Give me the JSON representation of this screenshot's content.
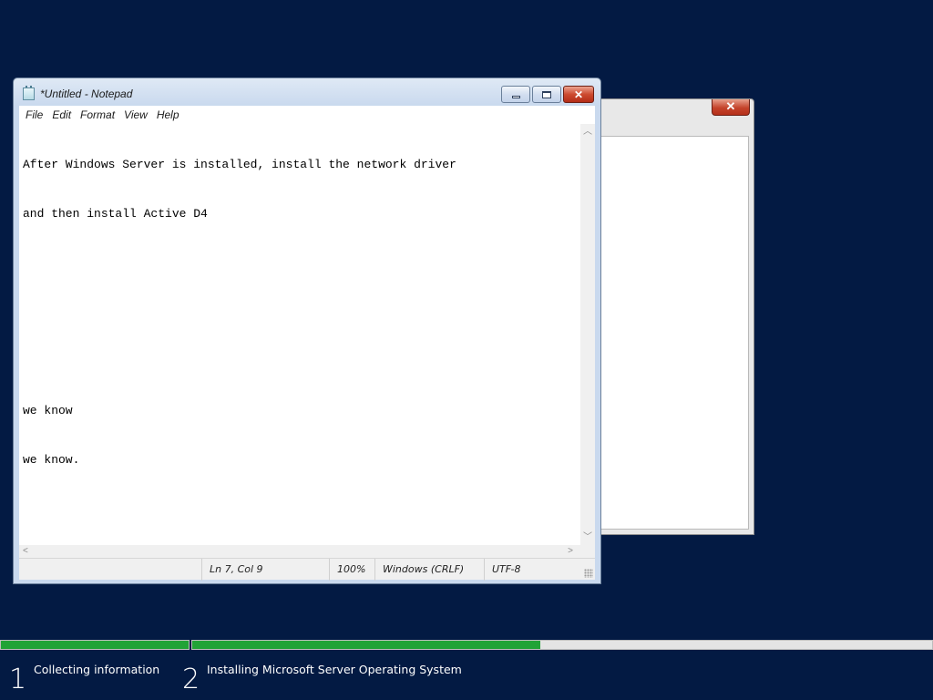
{
  "background_window": {
    "close_glyph": "✕"
  },
  "notepad": {
    "title": "*Untitled - Notepad",
    "buttons": {
      "close_glyph": "✕"
    },
    "menu": [
      "File",
      "Edit",
      "Format",
      "View",
      "Help"
    ],
    "lines": [
      "After Windows Server is installed, install the network driver",
      "and then install Active D4",
      "",
      "",
      "",
      "we know",
      "we know."
    ],
    "status": {
      "position": "Ln 7, Col 9",
      "zoom": "100%",
      "line_ending": "Windows (CRLF)",
      "encoding": "UTF-8"
    }
  },
  "setup": {
    "steps": [
      {
        "number": "1",
        "label": "Collecting information",
        "progress": 1.0
      },
      {
        "number": "2",
        "label": "Installing Microsoft Server Operating System",
        "progress": 0.47
      }
    ],
    "colors": {
      "progress_fill": "#21a336",
      "background": "#031a43"
    }
  }
}
